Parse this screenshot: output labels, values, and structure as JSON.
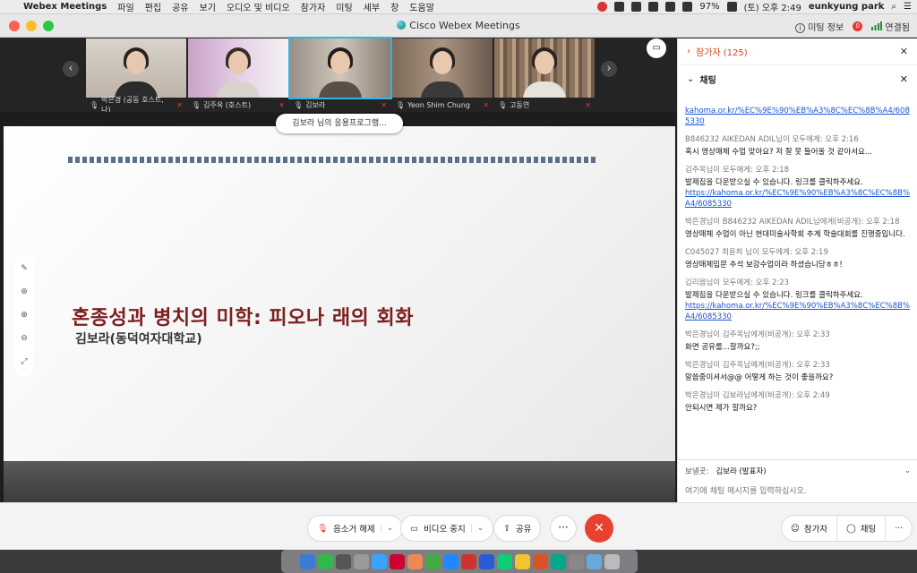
{
  "menubar": {
    "app_name": "Webex Meetings",
    "menus": [
      "파일",
      "편집",
      "공유",
      "보기",
      "오디오 및 비디오",
      "참가자",
      "미팅",
      "세부",
      "창",
      "도움말"
    ],
    "battery": "97%",
    "clock": "(토) 오후 2:49",
    "user": "eunkyung park"
  },
  "window": {
    "title": "Cisco Webex Meetings",
    "meeting_info": "미팅 정보",
    "connected": "연결됨",
    "rec_badge": "0"
  },
  "video_strip": {
    "tiles": [
      {
        "name": "박은경 (공동 호스트, 나)"
      },
      {
        "name": "김주옥 (호스트)"
      },
      {
        "name": "김보라"
      },
      {
        "name": "Yeon Shim Chung"
      },
      {
        "name": "고동연"
      }
    ]
  },
  "share": {
    "banner": "김보라 님의 응용프로그램...",
    "slide_title": "혼종성과 병치의 미학: 피오나 래의 회화",
    "slide_subtitle": "김보라(동덕여자대학교)"
  },
  "panel": {
    "participants_label": "참가자 (125)",
    "chat_label": "채팅",
    "messages": [
      {
        "head": "",
        "body": "",
        "link": "kahoma.or.kr/%EC%9E%90%EB%A3%8C%EC%8B%A4/6085330"
      },
      {
        "head": "B846232 AIKEDAN ADIL님이 모두에게:   오후 2:16",
        "body": "혹시 영상매체 수업 맞아요? 저 잘 못 들어올 것 같아서요...",
        "link": ""
      },
      {
        "head": "김주옥님이 모두에게:   오후 2:18",
        "body": "발제집을 다운받으실 수 있습니다. 링크를 클릭하주세요.",
        "link": "https://kahoma.or.kr/%EC%9E%90%EB%A3%8C%EC%8B%A4/6085330"
      },
      {
        "head": "박은경님이 B846232 AIKEDAN ADIL님에게(비공개):   오후 2:18",
        "body": "영상매체 수업이 아닌 현대미술사학회 추계 학술대회를 진행중입니다.",
        "link": ""
      },
      {
        "head": "C045027 최윤희 님이 모두에게:   오후 2:19",
        "body": "영상매체입문 추석 보강수업이라 하셨습니당ㅎㅎ!",
        "link": ""
      },
      {
        "head": "김리음님이 모두에게:   오후 2:23",
        "body": "발제집을 다운받으실 수 있습니다. 링크를 클릭하주세요.",
        "link": "https://kahoma.or.kr/%EC%9E%90%EB%A3%8C%EC%8B%A4/6085330"
      },
      {
        "head": "박은경님이 김주옥님에게(비공개):   오후 2:33",
        "body": "화면 공유를...할까요?;;",
        "link": ""
      },
      {
        "head": "박은경님이 김주옥님에게(비공개):   오후 2:33",
        "body": "말씀중이셔서@@ 어떻게 하는 것이 좋을까요?",
        "link": ""
      },
      {
        "head": "박은경님이 김보라님에게(비공개):   오후 2:49",
        "body": "안되시면 제가 할까요?",
        "link": ""
      }
    ],
    "send_to_label": "보낼곳:",
    "send_to_value": "김보라 (발표자)",
    "input_placeholder": "여기에 채팅 메시지를 입력하십시오."
  },
  "controls": {
    "unmute": "음소거 해제",
    "stop_video": "비디오 중지",
    "share": "공유",
    "participants": "참가자",
    "chat": "채팅"
  },
  "colors": {
    "accent": "#d9441e",
    "end_call": "#e8412f",
    "slide_title": "#7d1f1f",
    "link": "#1a55d3"
  }
}
